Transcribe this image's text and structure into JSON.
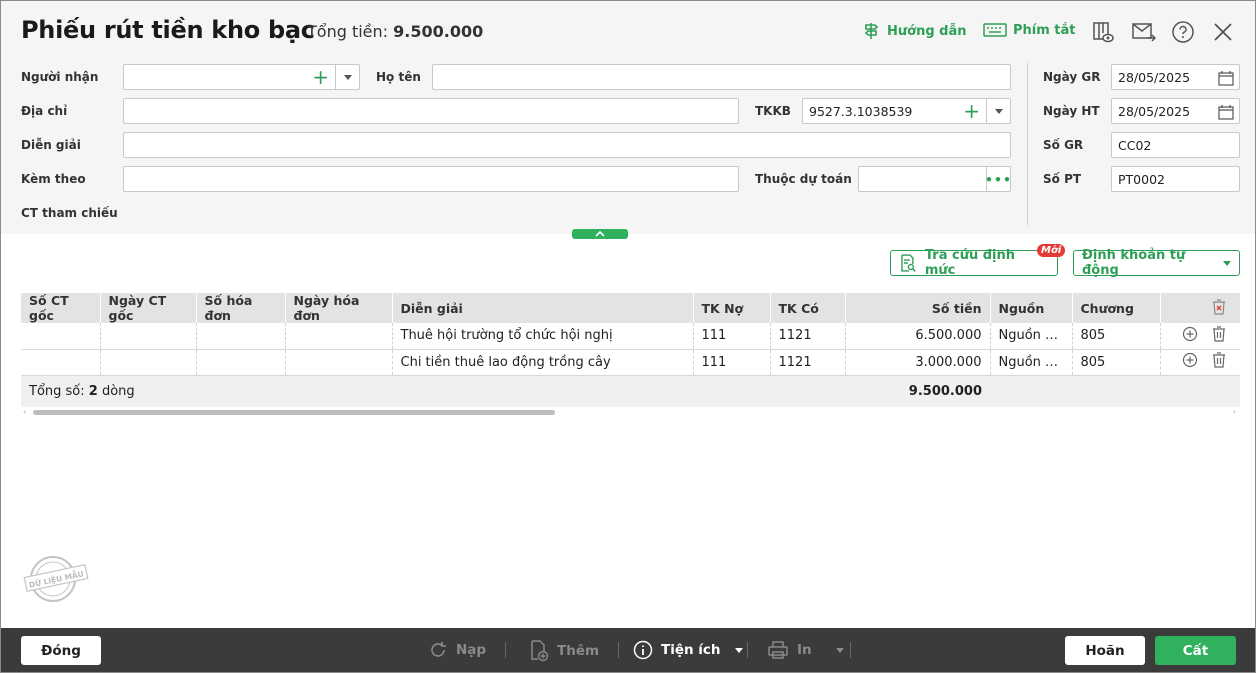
{
  "header": {
    "title": "Phiếu rút tiền kho bạc",
    "total_label": "Tổng tiền:",
    "total_value": "9.500.000",
    "guide": "Hướng dẫn",
    "shortcuts": "Phím tắt"
  },
  "form": {
    "nguoi_nhan_label": "Người nhận",
    "nguoi_nhan_value": "",
    "ho_ten_label": "Họ tên",
    "ho_ten_value": "",
    "dia_chi_label": "Địa chỉ",
    "dia_chi_value": "",
    "tkkb_label": "TKKB",
    "tkkb_value": "9527.3.1038539",
    "dien_giai_label": "Diễn giải",
    "dien_giai_value": "",
    "kem_theo_label": "Kèm theo",
    "kem_theo_value": "",
    "thuoc_du_toan_label": "Thuộc dự toán",
    "thuoc_du_toan_value": "",
    "ct_tham_chieu_label": "CT tham chiếu",
    "ngay_gr_label": "Ngày GR",
    "ngay_gr_value": "28/05/2025",
    "ngay_ht_label": "Ngày HT",
    "ngay_ht_value": "28/05/2025",
    "so_gr_label": "Số GR",
    "so_gr_value": "CC02",
    "so_pt_label": "Số PT",
    "so_pt_value": "PT0002"
  },
  "actions": {
    "tra_cuu": "Tra cứu định mức",
    "new_badge": "Mới",
    "dinh_khoan": "Định khoản tự động"
  },
  "table": {
    "columns": [
      "Số CT gốc",
      "Ngày CT gốc",
      "Số hóa đơn",
      "Ngày hóa đơn",
      "Diễn giải",
      "TK Nợ",
      "TK Có",
      "Số tiền",
      "Nguồn",
      "Chương"
    ],
    "rows": [
      {
        "so_ct": "",
        "ngay_ct": "",
        "so_hd": "",
        "ngay_hd": "",
        "dien_giai": "Thuê hội trường tổ chức hội nghị",
        "tk_no": "111",
        "tk_co": "1121",
        "so_tien": "6.500.000",
        "nguon": "Nguồn n...",
        "chuong": "805"
      },
      {
        "so_ct": "",
        "ngay_ct": "",
        "so_hd": "",
        "ngay_hd": "",
        "dien_giai": "Chi tiền thuê lao động trồng cây",
        "tk_no": "111",
        "tk_co": "1121",
        "so_tien": "3.000.000",
        "nguon": "Nguồn n...",
        "chuong": "805"
      }
    ],
    "footer_label": "Tổng số:",
    "footer_count": "2",
    "footer_unit": "dòng",
    "footer_total": "9.500.000"
  },
  "stamp_text": "DỮ LIỆU MẪU",
  "bottom": {
    "close": "Đóng",
    "reload": "Nạp",
    "add": "Thêm",
    "utility": "Tiện ích",
    "print": "In",
    "cancel": "Hoãn",
    "save": "Cất"
  },
  "colors": {
    "accent": "#2f9e57",
    "save_button": "#2fb15e",
    "badge": "#e53935",
    "bottom_bar": "#3b3b3b"
  }
}
